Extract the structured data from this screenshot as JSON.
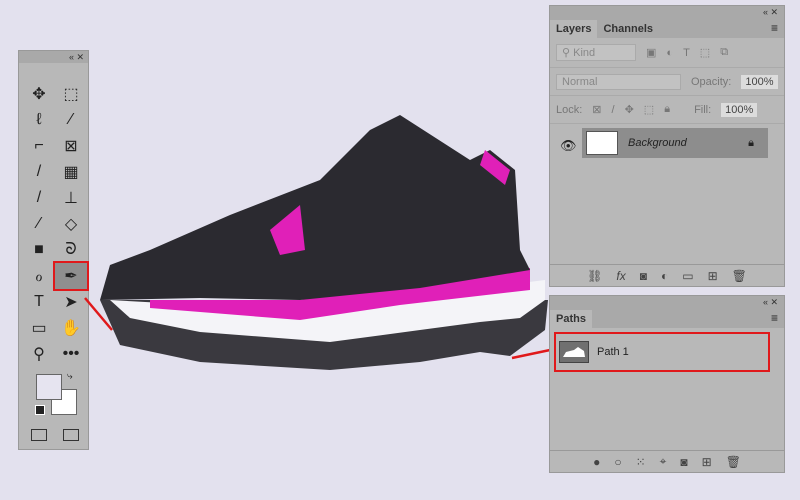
{
  "tools": {
    "header": "«  ✕",
    "items": [
      {
        "name": "move-tool",
        "glyph": "✥"
      },
      {
        "name": "marquee-tool",
        "glyph": "⬚"
      },
      {
        "name": "lasso-tool",
        "glyph": "ℓ"
      },
      {
        "name": "magic-wand-tool",
        "glyph": "⁄"
      },
      {
        "name": "crop-tool",
        "glyph": "⌐"
      },
      {
        "name": "frame-tool",
        "glyph": "⊠"
      },
      {
        "name": "eyedropper-tool",
        "glyph": "/"
      },
      {
        "name": "patch-tool",
        "glyph": "▦"
      },
      {
        "name": "brush-tool",
        "glyph": "/"
      },
      {
        "name": "stamp-tool",
        "glyph": "⊥"
      },
      {
        "name": "history-brush-tool",
        "glyph": "⁄"
      },
      {
        "name": "eraser-tool",
        "glyph": "◇"
      },
      {
        "name": "gradient-tool",
        "glyph": "■"
      },
      {
        "name": "blur-tool",
        "glyph": "ᘐ"
      },
      {
        "name": "dodge-tool",
        "glyph": "ℴ"
      },
      {
        "name": "pen-tool",
        "glyph": "✒",
        "selected": true
      },
      {
        "name": "type-tool",
        "glyph": "T"
      },
      {
        "name": "path-selection-tool",
        "glyph": "➤"
      },
      {
        "name": "rectangle-tool",
        "glyph": "▭"
      },
      {
        "name": "hand-tool",
        "glyph": "✋"
      },
      {
        "name": "zoom-tool",
        "glyph": "⚲"
      },
      {
        "name": "more-tools",
        "glyph": "•••"
      }
    ],
    "foreground": "#e6e4f0",
    "background": "#ffffff"
  },
  "layers": {
    "header": "«  ✕",
    "tabs": [
      "Layers",
      "Channels"
    ],
    "filter": "Kind",
    "blend": "Normal",
    "opacity_label": "Opacity:",
    "opacity": "100%",
    "lock_label": "Lock:",
    "fill_label": "Fill:",
    "fill": "100%",
    "items": [
      {
        "name": "Background",
        "locked": true,
        "visible": true
      }
    ]
  },
  "paths": {
    "header": "«  ✕",
    "tab": "Paths",
    "items": [
      {
        "name": "Path 1"
      }
    ]
  },
  "colors": {
    "accent": "#e0191b",
    "magenta": "#e020b8",
    "shoe": "#2b2a30"
  }
}
